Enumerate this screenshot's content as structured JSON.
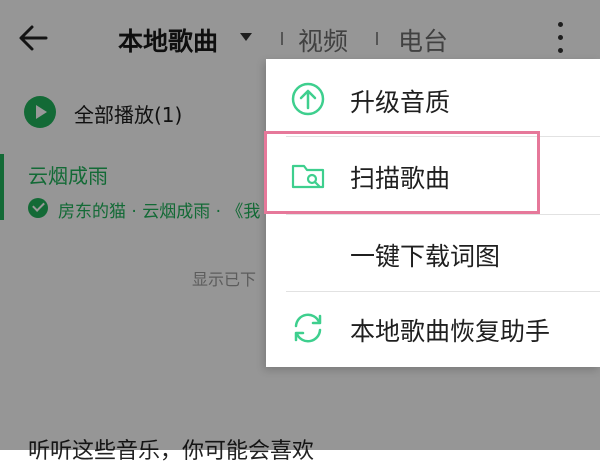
{
  "header": {
    "title": "本地歌曲",
    "tabs": [
      "视频",
      "电台"
    ]
  },
  "list": {
    "play_all_label": "全部播放(1)",
    "song": {
      "title": "云烟成雨",
      "subtitle": "房东的猫 · 云烟成雨 · 《我"
    },
    "hint_text": "显示已下",
    "bottom_text": "听听这些音乐，你可能会喜欢"
  },
  "menu": {
    "items": [
      {
        "label": "升级音质",
        "icon": "upgrade-arrow-icon"
      },
      {
        "label": "扫描歌曲",
        "icon": "folder-search-icon",
        "highlighted": true
      },
      {
        "label": "一键下载词图",
        "icon": ""
      },
      {
        "label": "本地歌曲恢复助手",
        "icon": "refresh-arrows-icon"
      }
    ]
  },
  "colors": {
    "accent_green": "#20b15a",
    "highlight_pink": "#e6789a",
    "overlay": "rgba(0,0,0,0.40)"
  }
}
